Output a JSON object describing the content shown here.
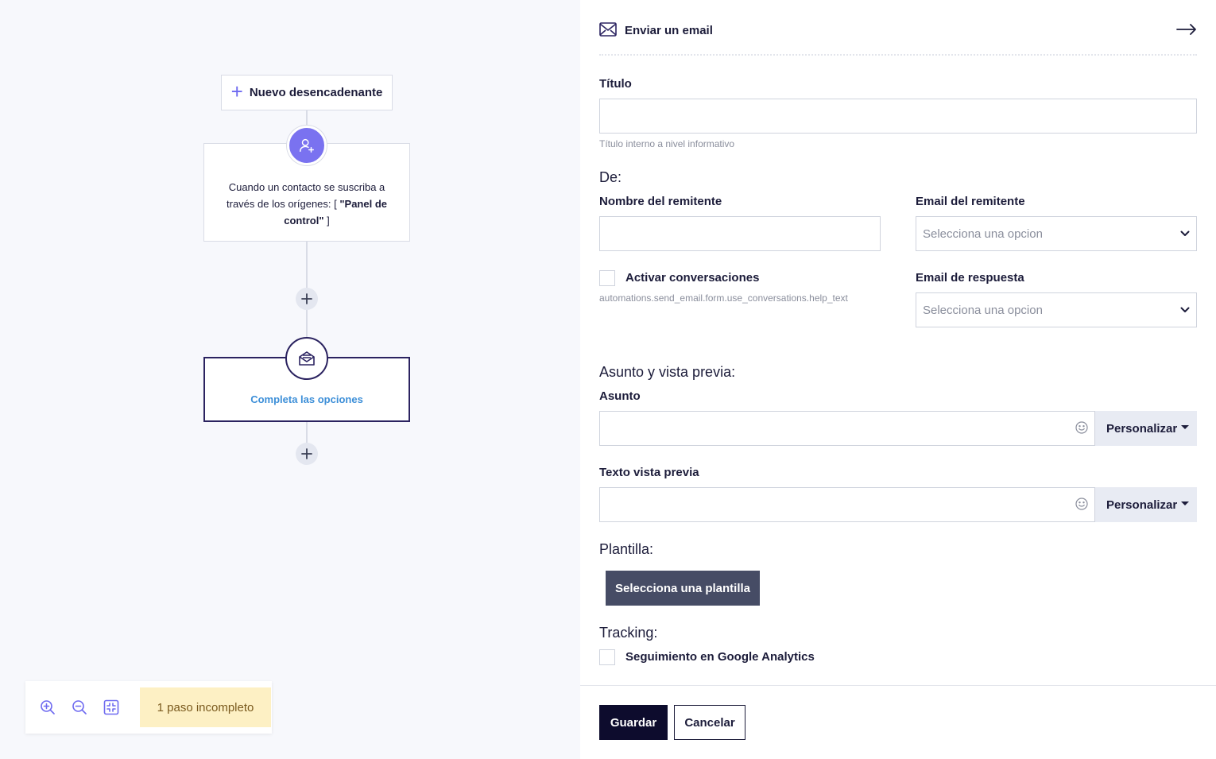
{
  "canvas": {
    "new_trigger_label": "Nuevo desencadenante",
    "trigger_card": {
      "text_before": "Cuando un contacto se suscriba a través de los orígenes: [ ",
      "text_bold": "\"Panel de control\"",
      "text_after": " ]"
    },
    "email_step": {
      "status_text": "Completa las opciones"
    },
    "zoom": {
      "incomplete_label": "1 paso incompleto"
    }
  },
  "panel": {
    "header": {
      "title": "Enviar un email"
    },
    "titulo": {
      "label": "Título",
      "value": "",
      "help": "Título interno a nivel informativo"
    },
    "from_section": "De:",
    "sender_name": {
      "label": "Nombre del remitente",
      "value": ""
    },
    "sender_email": {
      "label": "Email del remitente",
      "placeholder": "Selecciona una opcion"
    },
    "conversations": {
      "label": "Activar conversaciones",
      "help": "automations.send_email.form.use_conversations.help_text",
      "checked": false
    },
    "reply_email": {
      "label": "Email de respuesta",
      "placeholder": "Selecciona una opcion"
    },
    "subject_section": "Asunto y vista previa:",
    "subject": {
      "label": "Asunto",
      "value": "",
      "personalize_label": "Personalizar"
    },
    "preview_text": {
      "label": "Texto vista previa",
      "value": "",
      "personalize_label": "Personalizar"
    },
    "template_section": "Plantilla:",
    "template_button": "Selecciona una plantilla",
    "tracking_section": "Tracking:",
    "ga_tracking": {
      "label": "Seguimiento en Google Analytics",
      "checked": false
    },
    "footer": {
      "save_label": "Guardar",
      "cancel_label": "Cancelar"
    }
  },
  "colors": {
    "accent": "#6e6af0",
    "trigger_icon_bg": "#7a72f0",
    "email_step_border": "#2b2360",
    "status_link": "#3d8fd8",
    "badge_bg": "#fdf0c4",
    "primary_button": "#0d0c2d",
    "template_button": "#464c65"
  }
}
